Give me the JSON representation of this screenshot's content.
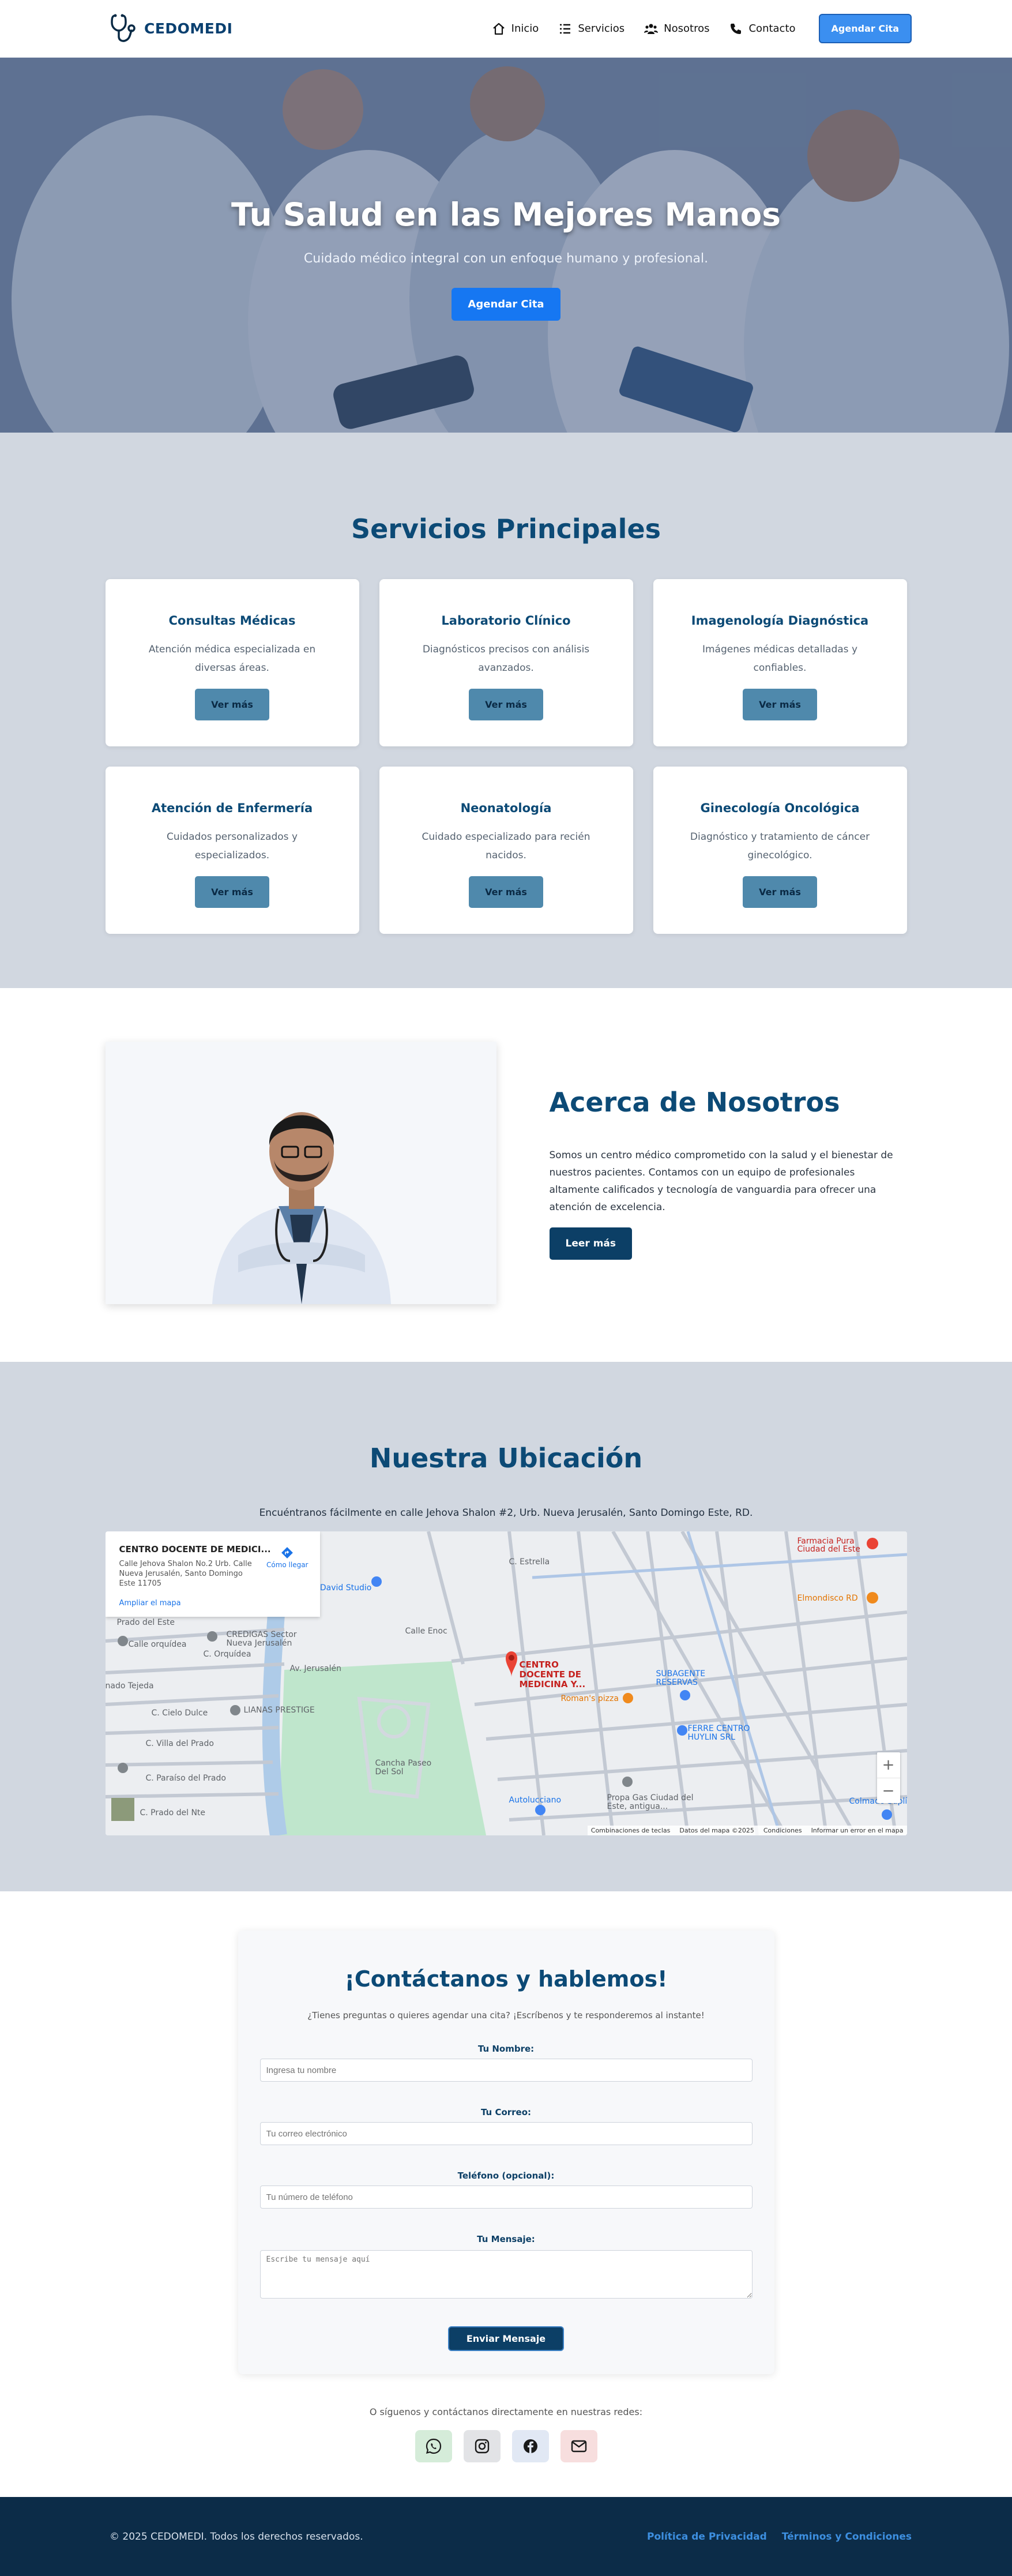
{
  "nav": {
    "brand": "CEDOMEDI",
    "links": [
      {
        "label": "Inicio",
        "icon": "home-icon"
      },
      {
        "label": "Servicios",
        "icon": "list-icon"
      },
      {
        "label": "Nosotros",
        "icon": "users-icon"
      },
      {
        "label": "Contacto",
        "icon": "phone-icon"
      }
    ],
    "cta": "Agendar Cita"
  },
  "hero": {
    "title": "Tu Salud en las Mejores Manos",
    "subtitle": "Cuidado médico integral con un enfoque humano y profesional.",
    "button": "Agendar Cita"
  },
  "services": {
    "title": "Servicios Principales",
    "button_label": "Ver más",
    "items": [
      {
        "title": "Consultas Médicas",
        "desc": "Atención médica especializada en diversas áreas."
      },
      {
        "title": "Laboratorio Clínico",
        "desc": "Diagnósticos precisos con análisis avanzados."
      },
      {
        "title": "Imagenología Diagnóstica",
        "desc": "Imágenes médicas detalladas y confiables."
      },
      {
        "title": "Atención de Enfermería",
        "desc": "Cuidados personalizados y especializados."
      },
      {
        "title": "Neonatología",
        "desc": "Cuidado especializado para recién nacidos."
      },
      {
        "title": "Ginecología Oncológica",
        "desc": "Diagnóstico y tratamiento de cáncer ginecológico."
      }
    ]
  },
  "about": {
    "title": "Acerca de Nosotros",
    "desc": "Somos un centro médico comprometido con la salud y el bienestar de nuestros pacientes. Contamos con un equipo de profesionales altamente calificados y tecnología de vanguardia para ofrecer una atención de excelencia.",
    "button": "Leer más"
  },
  "location": {
    "title": "Nuestra Ubicación",
    "desc": "Encuéntranos fácilmente en calle Jehova Shalon #2, Urb. Nueva Jerusalén, Santo Domingo Este, RD.",
    "map": {
      "card_title": "CENTRO DOCENTE DE MEDICI...",
      "card_address": "Calle Jehova Shalon No.2 Urb. Calle Nueva Jerusalén, Santo Domingo Este 11705",
      "card_link": "Ampliar el mapa",
      "directions": "Cómo llegar",
      "pin_label": "CENTRO DOCENTE DE MEDICINA Y...",
      "places": [
        "Farmacia Pura Ciudad del Este",
        "Elmondisco RD",
        "BigDavid Studio",
        "Calle orquídea",
        "CREDIGAS Sector Nueva Jerusalén",
        "LIANAS PRESTIGE",
        "SUBAGENTE RESERVAS",
        "Roman's pizza",
        "FERRE CENTRO HUYLIN SRL",
        "Cancha Paseo Del Sol",
        "Autolucciano",
        "Propa Gas Ciudad del Este, antigua...",
        "Colmado Suplí S...",
        "C. Estrella",
        "Av. Jerusalén",
        "C. Orquídea",
        "C. Cielo Dulce",
        "C. Villa del Prado",
        "C. Paraíso del Prado",
        "C. Prado del Nte",
        "Calle Enoc",
        "Prado del Este",
        "nado Tejeda"
      ],
      "footer": [
        "Combinaciones de teclas",
        "Datos del mapa ©2025",
        "Condiciones",
        "Informar un error en el mapa"
      ],
      "zoom_in": "+",
      "zoom_out": "−"
    }
  },
  "contact": {
    "title": "¡Contáctanos y hablemos!",
    "subtitle": "¿Tienes preguntas o quieres agendar una cita? ¡Escríbenos y te responderemos al instante!",
    "fields": [
      {
        "label": "Tu Nombre:",
        "placeholder": "Ingresa tu nombre"
      },
      {
        "label": "Tu Correo:",
        "placeholder": "Tu correo electrónico"
      },
      {
        "label": "Teléfono (opcional):",
        "placeholder": "Tu número de teléfono"
      },
      {
        "label": "Tu Mensaje:",
        "placeholder": "Escribe tu mensaje aquí"
      }
    ],
    "submit": "Enviar Mensaje",
    "social_text": "O síguenos y contáctanos directamente en nuestras redes:",
    "social": [
      {
        "icon": "whatsapp-icon",
        "bg": "#d5ecd9"
      },
      {
        "icon": "instagram-icon",
        "bg": "#e2e3e6"
      },
      {
        "icon": "facebook-icon",
        "bg": "#e1e8f4"
      },
      {
        "icon": "email-icon",
        "bg": "#f7dede"
      }
    ]
  },
  "footer": {
    "copy": "© 2025 CEDOMEDI. Todos los derechos reservados.",
    "links": [
      "Política de Privacidad",
      "Términos y Condiciones"
    ]
  },
  "colors": {
    "brand": "#0c4a76",
    "accent": "#1677f2",
    "section_bg": "#d1d7e0",
    "footer_bg": "#0c2c48",
    "service_button": "#4f89ac"
  }
}
